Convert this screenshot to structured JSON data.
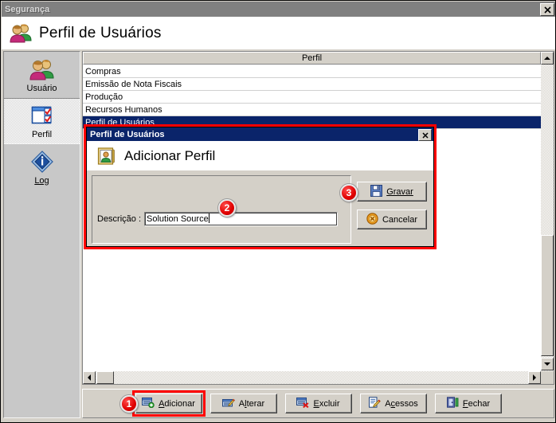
{
  "window": {
    "title": "Segurança",
    "close_label": "✕",
    "header_title": "Perfil de Usuários",
    "header_icon": "users-icon"
  },
  "sidebar": {
    "items": [
      {
        "label": "Usuário",
        "icon": "users-icon",
        "selected": false
      },
      {
        "label": "Perfil",
        "icon": "profile-checklist-icon",
        "selected": true
      },
      {
        "label": "Log",
        "icon": "info-diamond-icon",
        "selected": false
      }
    ]
  },
  "grid": {
    "column_header": "Perfil",
    "rows": [
      {
        "label": "Compras",
        "selected": false
      },
      {
        "label": "Emissão de Nota Fiscais",
        "selected": false
      },
      {
        "label": "Produção",
        "selected": false
      },
      {
        "label": "Recursos Humanos",
        "selected": false
      },
      {
        "label": "Perfil de Usuários",
        "selected": true
      }
    ],
    "scrollbar": {
      "up_icon": "scroll-up-arrow",
      "down_icon": "scroll-down-arrow",
      "left_icon": "scroll-left-arrow",
      "right_icon": "scroll-right-arrow"
    }
  },
  "dialog": {
    "title": "Perfil de Usuários",
    "close_label": "✕",
    "heading": "Adicionar Perfil",
    "heading_icon": "user-card-icon",
    "field": {
      "label": "Descrição :",
      "value": "Solution Source",
      "placeholder": ""
    },
    "buttons": [
      {
        "label": "Gravar",
        "accesskey": "G",
        "icon": "floppy-save-icon"
      },
      {
        "label": "Cancelar",
        "accesskey": "",
        "icon": "cancel-circle-icon"
      }
    ]
  },
  "toolbar": {
    "buttons": [
      {
        "label": "Adicionar",
        "accesskey": "A",
        "icon": "add-record-icon",
        "highlighted": true
      },
      {
        "label": "Alterar",
        "accesskey": "l",
        "icon": "edit-record-icon",
        "highlighted": false
      },
      {
        "label": "Excluir",
        "accesskey": "E",
        "icon": "delete-record-icon",
        "highlighted": false
      },
      {
        "label": "Acessos",
        "accesskey": "c",
        "icon": "permissions-icon",
        "highlighted": false
      },
      {
        "label": "Fechar",
        "accesskey": "F",
        "icon": "exit-door-icon",
        "highlighted": false
      }
    ]
  },
  "badges": {
    "one": "1",
    "two": "2",
    "three": "3"
  },
  "colors": {
    "selection_blue": "#0a246a",
    "highlight_red": "#ff0000",
    "face": "#d4d0c8",
    "inactive_title": "#808080"
  }
}
